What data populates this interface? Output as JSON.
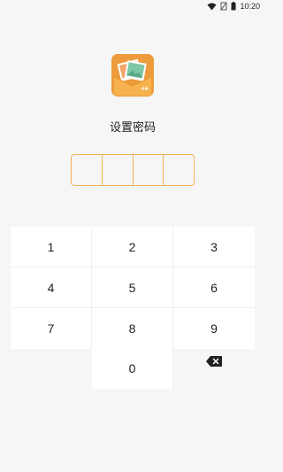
{
  "status_bar": {
    "time": "10:20",
    "icons": [
      "wifi-icon",
      "no-sim-icon",
      "battery-icon"
    ]
  },
  "app": {
    "icon": "photo-envelope-icon",
    "colors": {
      "accent": "#f1b35a",
      "logo_orange": "#ee9b3b",
      "logo_green": "#7fc6a4"
    }
  },
  "prompt": "设置密码",
  "pin": {
    "slots": [
      "",
      "",
      "",
      ""
    ]
  },
  "keypad": {
    "keys": [
      "1",
      "2",
      "3",
      "4",
      "5",
      "6",
      "7",
      "8",
      "9",
      "0"
    ],
    "delete_icon": "backspace-icon"
  }
}
